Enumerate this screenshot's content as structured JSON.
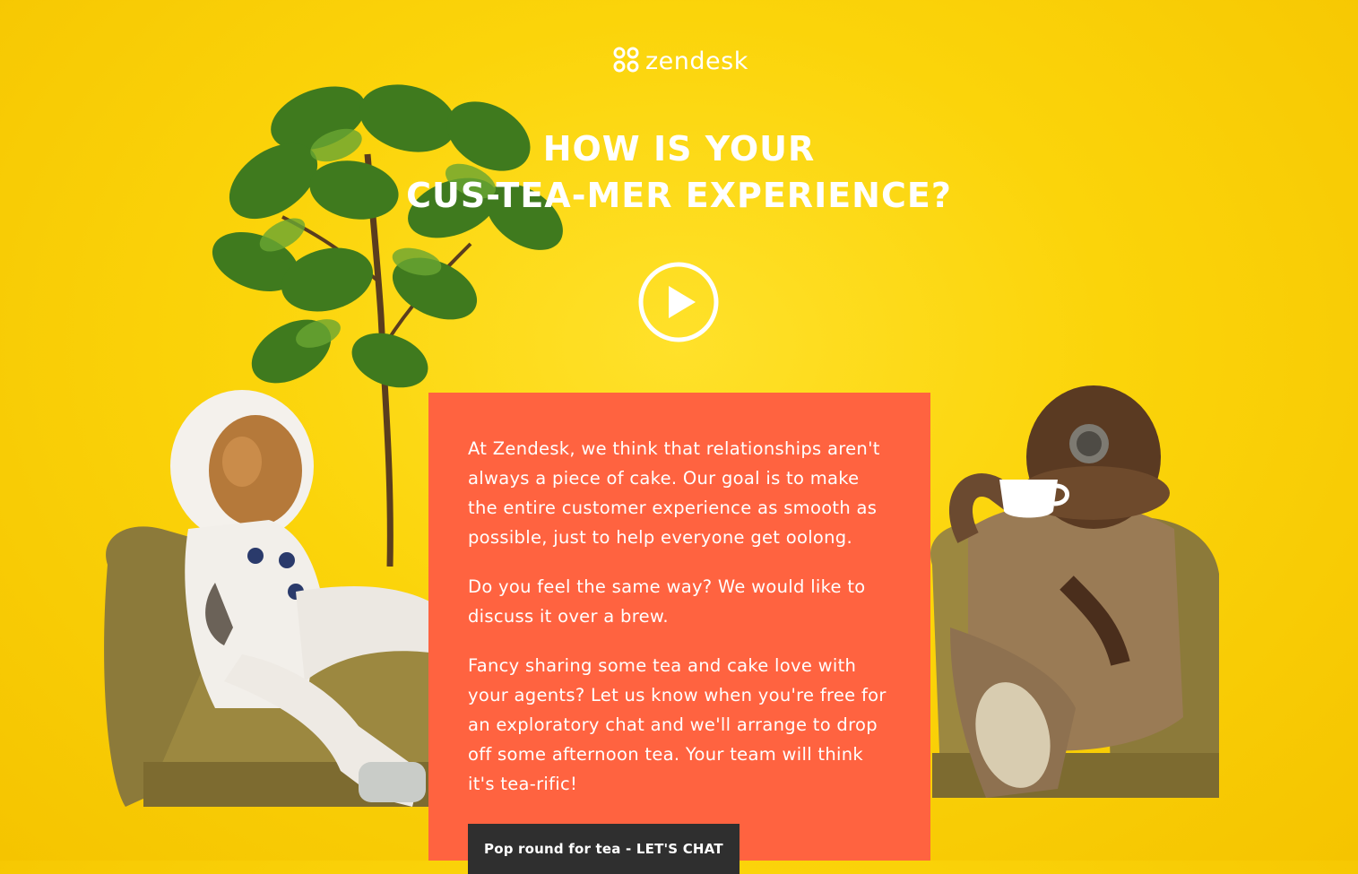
{
  "brand": {
    "name": "zendesk",
    "logo_icon": "zendesk-logo-icon"
  },
  "hero": {
    "headline_line1": "HOW IS YOUR",
    "headline_line2": "CUS-TEA-MER EXPERIENCE?",
    "play_icon": "play-icon"
  },
  "card": {
    "paragraph1": "At Zendesk, we think that relationships aren't always a piece of cake. Our goal is to make the entire customer experience as smooth as possible, just to help everyone get oolong.",
    "paragraph2": "Do you feel the same way? We would like to discuss it over a brew.",
    "paragraph3": "Fancy sharing some tea and cake love with your agents? Let us know when you're free for an exploratory chat and we'll arrange to drop off some afternoon tea. Your team will think it's tea-rific!",
    "cta_label": "Pop round for tea - LET'S CHAT"
  },
  "colors": {
    "background": "#fbd40a",
    "card": "#ff6340",
    "cta": "#2f2f2f",
    "text": "#ffffff"
  }
}
